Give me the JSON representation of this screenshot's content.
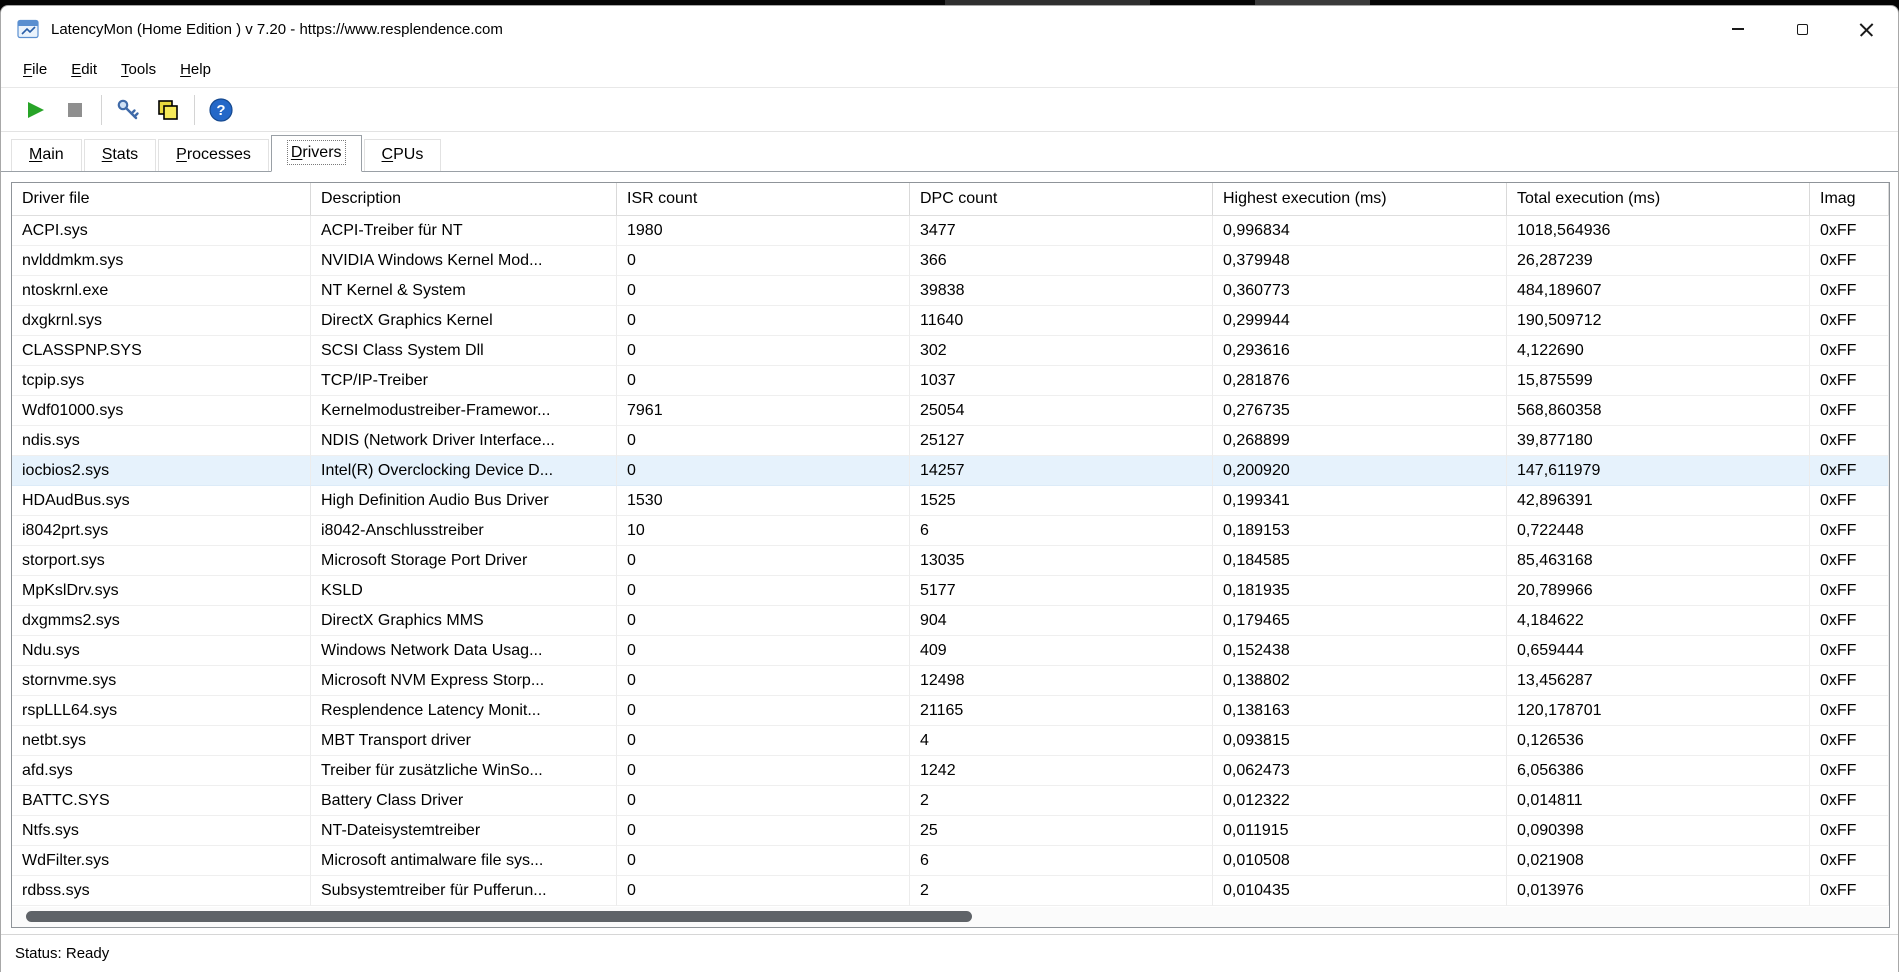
{
  "window": {
    "title": "LatencyMon  (Home Edition )  v 7.20 - https://www.resplendence.com"
  },
  "menu": {
    "items": [
      {
        "first": "F",
        "rest": "ile"
      },
      {
        "first": "E",
        "rest": "dit"
      },
      {
        "first": "T",
        "rest": "ools"
      },
      {
        "first": "H",
        "rest": "elp"
      }
    ]
  },
  "toolbar": {
    "buttons": [
      {
        "name": "play",
        "color": "#28a428"
      },
      {
        "name": "stop",
        "color": "#8f8f8f"
      },
      {
        "name": "analyze",
        "color": "#3f6aa8"
      },
      {
        "name": "copy",
        "color": "#efe049"
      },
      {
        "name": "help",
        "color": "#2468c8",
        "glyph": "?"
      }
    ]
  },
  "tabs": {
    "active": "Drivers",
    "items": [
      {
        "first": "M",
        "rest": "ain"
      },
      {
        "first": "S",
        "rest": "tats"
      },
      {
        "first": "P",
        "rest": "rocesses"
      },
      {
        "first": "D",
        "rest": "rivers"
      },
      {
        "first": "C",
        "rest": "PUs"
      }
    ]
  },
  "table": {
    "columns": [
      "Driver file",
      "Description",
      "ISR count",
      "DPC count",
      "Highest execution (ms)",
      "Total execution (ms)",
      "Imag"
    ],
    "selected_index": 8,
    "selected_driver": "iocbios2.sys",
    "selection_color": "#e6f2fc",
    "rows": [
      [
        "ACPI.sys",
        "ACPI-Treiber für NT",
        "1980",
        "3477",
        "0,996834",
        "1018,564936",
        "0xFF"
      ],
      [
        "nvlddmkm.sys",
        "NVIDIA Windows Kernel Mod...",
        "0",
        "366",
        "0,379948",
        "26,287239",
        "0xFF"
      ],
      [
        "ntoskrnl.exe",
        "NT Kernel & System",
        "0",
        "39838",
        "0,360773",
        "484,189607",
        "0xFF"
      ],
      [
        "dxgkrnl.sys",
        "DirectX Graphics Kernel",
        "0",
        "11640",
        "0,299944",
        "190,509712",
        "0xFF"
      ],
      [
        "CLASSPNP.SYS",
        "SCSI Class System Dll",
        "0",
        "302",
        "0,293616",
        "4,122690",
        "0xFF"
      ],
      [
        "tcpip.sys",
        "TCP/IP-Treiber",
        "0",
        "1037",
        "0,281876",
        "15,875599",
        "0xFF"
      ],
      [
        "Wdf01000.sys",
        "Kernelmodustreiber-Framewor...",
        "7961",
        "25054",
        "0,276735",
        "568,860358",
        "0xFF"
      ],
      [
        "ndis.sys",
        "NDIS (Network Driver Interface...",
        "0",
        "25127",
        "0,268899",
        "39,877180",
        "0xFF"
      ],
      [
        "iocbios2.sys",
        "Intel(R) Overclocking Device D...",
        "0",
        "14257",
        "0,200920",
        "147,611979",
        "0xFF"
      ],
      [
        "HDAudBus.sys",
        "High Definition Audio Bus Driver",
        "1530",
        "1525",
        "0,199341",
        "42,896391",
        "0xFF"
      ],
      [
        "i8042prt.sys",
        "i8042-Anschlusstreiber",
        "10",
        "6",
        "0,189153",
        "0,722448",
        "0xFF"
      ],
      [
        "storport.sys",
        "Microsoft Storage Port Driver",
        "0",
        "13035",
        "0,184585",
        "85,463168",
        "0xFF"
      ],
      [
        "MpKslDrv.sys",
        "KSLD",
        "0",
        "5177",
        "0,181935",
        "20,789966",
        "0xFF"
      ],
      [
        "dxgmms2.sys",
        "DirectX Graphics MMS",
        "0",
        "904",
        "0,179465",
        "4,184622",
        "0xFF"
      ],
      [
        "Ndu.sys",
        "Windows Network Data Usag...",
        "0",
        "409",
        "0,152438",
        "0,659444",
        "0xFF"
      ],
      [
        "stornvme.sys",
        "Microsoft NVM Express Storp...",
        "0",
        "12498",
        "0,138802",
        "13,456287",
        "0xFF"
      ],
      [
        "rspLLL64.sys",
        "Resplendence Latency Monit...",
        "0",
        "21165",
        "0,138163",
        "120,178701",
        "0xFF"
      ],
      [
        "netbt.sys",
        "MBT Transport driver",
        "0",
        "4",
        "0,093815",
        "0,126536",
        "0xFF"
      ],
      [
        "afd.sys",
        "Treiber für zusätzliche WinSo...",
        "0",
        "1242",
        "0,062473",
        "6,056386",
        "0xFF"
      ],
      [
        "BATTC.SYS",
        "Battery Class Driver",
        "0",
        "2",
        "0,012322",
        "0,014811",
        "0xFF"
      ],
      [
        "Ntfs.sys",
        "NT-Dateisystemtreiber",
        "0",
        "25",
        "0,011915",
        "0,090398",
        "0xFF"
      ],
      [
        "WdFilter.sys",
        "Microsoft antimalware file sys...",
        "0",
        "6",
        "0,010508",
        "0,021908",
        "0xFF"
      ],
      [
        "rdbss.sys",
        "Subsystemtreiber für Pufferun...",
        "0",
        "2",
        "0,010435",
        "0,013976",
        "0xFF"
      ]
    ]
  },
  "status_bar": {
    "text": "Status: Ready"
  }
}
